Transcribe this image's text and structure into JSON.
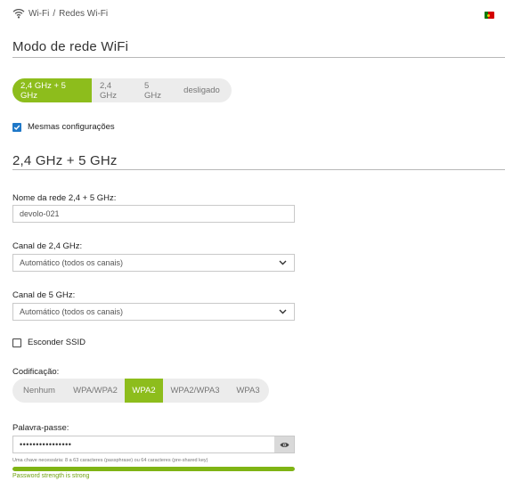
{
  "breadcrumb": {
    "parent": "Wi-Fi",
    "separator": "/",
    "current": "Redes Wi-Fi"
  },
  "mode_section": {
    "title": "Modo de rede WiFi",
    "options": [
      "2,4 GHz + 5 GHz",
      "2,4 GHz",
      "5 GHz",
      "desligado"
    ],
    "selected": "2,4 GHz + 5 GHz"
  },
  "same_settings": {
    "label": "Mesmas configurações",
    "checked": true
  },
  "band_section": {
    "title": "2,4 GHz + 5 GHz"
  },
  "network_name": {
    "label": "Nome da rede 2,4 + 5 GHz:",
    "value": "devolo-021"
  },
  "channel_24": {
    "label": "Canal de 2,4 GHz:",
    "value": "Automático (todos os canais)"
  },
  "channel_5": {
    "label": "Canal de 5 GHz:",
    "value": "Automático (todos os canais)"
  },
  "hide_ssid": {
    "label": "Esconder SSID",
    "checked": false
  },
  "encryption": {
    "label": "Codificação:",
    "options": [
      "Nenhum",
      "WPA/WPA2",
      "WPA2",
      "WPA2/WPA3",
      "WPA3"
    ],
    "selected": "WPA2"
  },
  "password": {
    "label": "Palavra-passe:",
    "masked_value": "••••••••••••••••",
    "hint": "Uma chave necessária: 8 a 63 caracteres (passphrase) ou 64 caracteres (pre-shared key)",
    "strength_fraction": 1.0,
    "strength_text": "Password strength is strong"
  },
  "colors": {
    "accent": "#8dbd1c",
    "checkbox": "#1f78c8",
    "strength": "#7fb414"
  },
  "icons": {
    "wifi": "wifi-icon",
    "flag": "portugal-flag-icon",
    "chevron": "chevron-down-icon",
    "eye": "eye-icon",
    "check": "check-icon"
  }
}
